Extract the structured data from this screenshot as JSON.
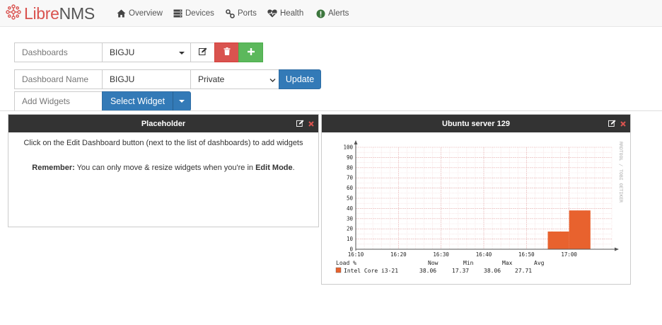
{
  "navbar": {
    "brand_left": "Libre",
    "brand_right": "NMS",
    "items": [
      {
        "label": "Overview",
        "icon": "home-icon"
      },
      {
        "label": "Devices",
        "icon": "server-icon"
      },
      {
        "label": "Ports",
        "icon": "link-icon"
      },
      {
        "label": "Health",
        "icon": "heartbeat-icon"
      },
      {
        "label": "Alerts",
        "icon": "exclamation-circle-icon"
      }
    ]
  },
  "dashboard_bar": {
    "dashboards_label": "Dashboards",
    "selected_dashboard": "BIGJU",
    "name_label": "Dashboard Name",
    "name_value": "BIGJU",
    "access_value": "Private",
    "update_label": "Update",
    "add_widgets_label": "Add Widgets",
    "select_widget_label": "Select Widget"
  },
  "colors": {
    "danger": "#d9534f",
    "success": "#5cb85c",
    "primary": "#337ab7",
    "header": "#333333",
    "series": "#e8622e"
  },
  "placeholder_widget": {
    "title": "Placeholder",
    "message": "Click on the Edit Dashboard button (next to the list of dashboards) to add widgets",
    "remember_bold": "Remember:",
    "remember_text": " You can only move & resize widgets when you're in ",
    "edit_mode": "Edit Mode",
    "period": "."
  },
  "graph_widget": {
    "title": "Ubuntu server 129",
    "watermark": "RRDTOOL / TOBI OETIKER"
  },
  "chart_data": {
    "type": "area",
    "x": [
      "16:10",
      "16:20",
      "16:30",
      "16:40",
      "16:50",
      "17:00"
    ],
    "y_ticks": [
      0,
      10,
      20,
      30,
      40,
      50,
      60,
      70,
      80,
      90,
      100
    ],
    "ylim": [
      0,
      100
    ],
    "grid": true,
    "series": [
      {
        "name": "Intel Core i3-21",
        "color": "#e8622e",
        "points": [
          {
            "from": "16:55",
            "to": "17:00",
            "value": 17.37
          },
          {
            "from": "17:00",
            "to": "17:05",
            "value": 38.06
          }
        ]
      }
    ],
    "legend": {
      "header": [
        "Load %",
        "Now",
        "Min",
        "Max",
        "Avg"
      ],
      "rows": [
        {
          "name": "Intel Core i3-21",
          "now": "38.06",
          "min": "17.37",
          "max": "38.06",
          "avg": "27.71"
        }
      ]
    }
  }
}
